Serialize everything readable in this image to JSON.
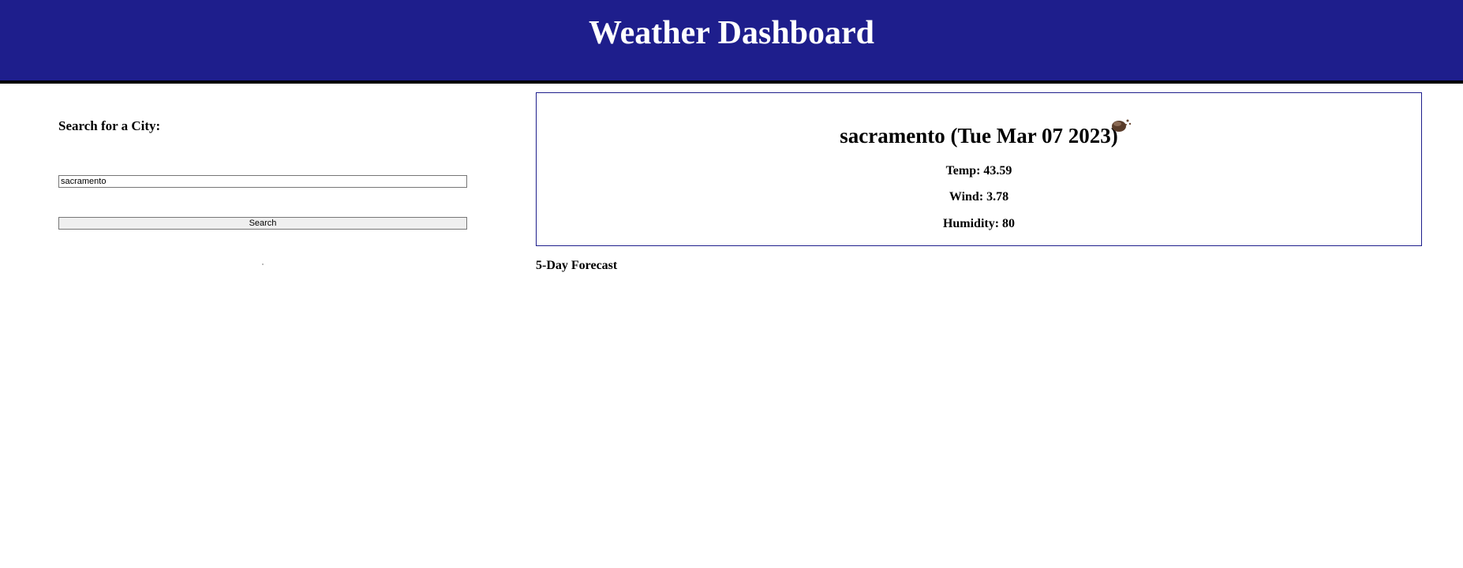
{
  "header": {
    "title": "Weather Dashboard"
  },
  "search": {
    "label": "Search for a City:",
    "input_value": "sacramento",
    "button_label": "Search"
  },
  "current": {
    "title": "sacramento (Tue Mar 07 2023)",
    "icon": "rain-cloud-icon",
    "temp": "Temp: 43.59",
    "wind": "Wind: 3.78",
    "humidity": "Humidity: 80"
  },
  "forecast": {
    "heading": "5-Day Forecast"
  },
  "colors": {
    "header_bg": "#1e1e8c",
    "card_border": "#1e1e8c"
  }
}
